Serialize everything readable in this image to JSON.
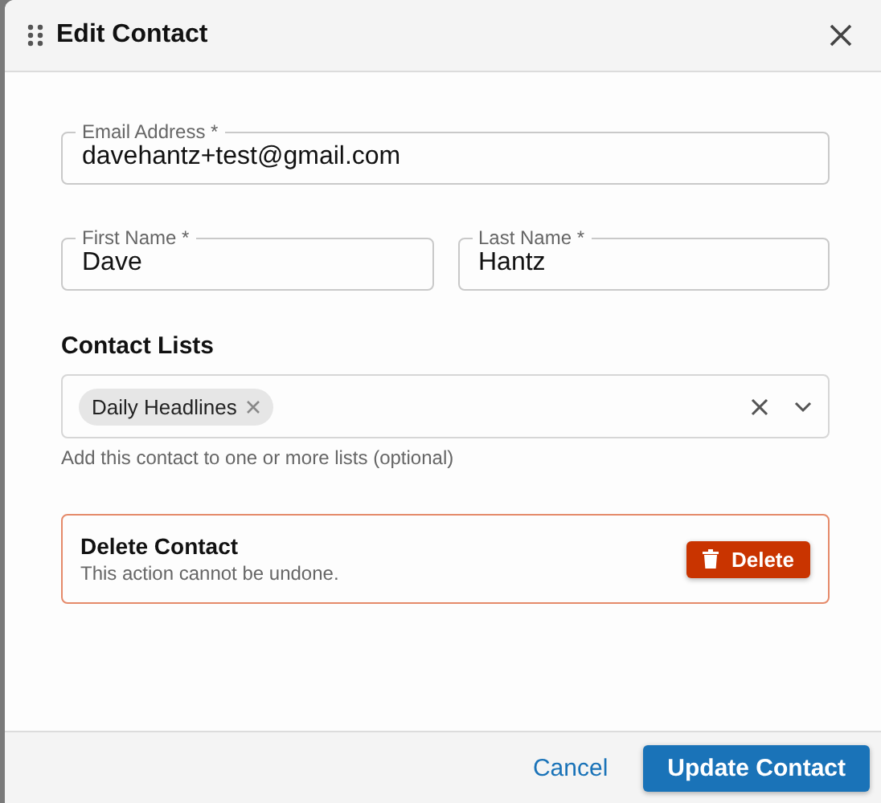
{
  "dialog": {
    "title": "Edit Contact"
  },
  "email": {
    "label": "Email Address *",
    "value": "davehantz+test@gmail.com"
  },
  "first_name": {
    "label": "First Name *",
    "value": "Dave"
  },
  "last_name": {
    "label": "Last Name *",
    "value": "Hantz"
  },
  "contact_lists": {
    "label": "Contact Lists",
    "chips": [
      {
        "label": "Daily Headlines"
      }
    ],
    "helper": "Add this contact to one or more lists (optional)"
  },
  "delete_section": {
    "title": "Delete Contact",
    "description": "This action cannot be undone.",
    "button": "Delete"
  },
  "footer": {
    "cancel": "Cancel",
    "submit": "Update Contact"
  }
}
